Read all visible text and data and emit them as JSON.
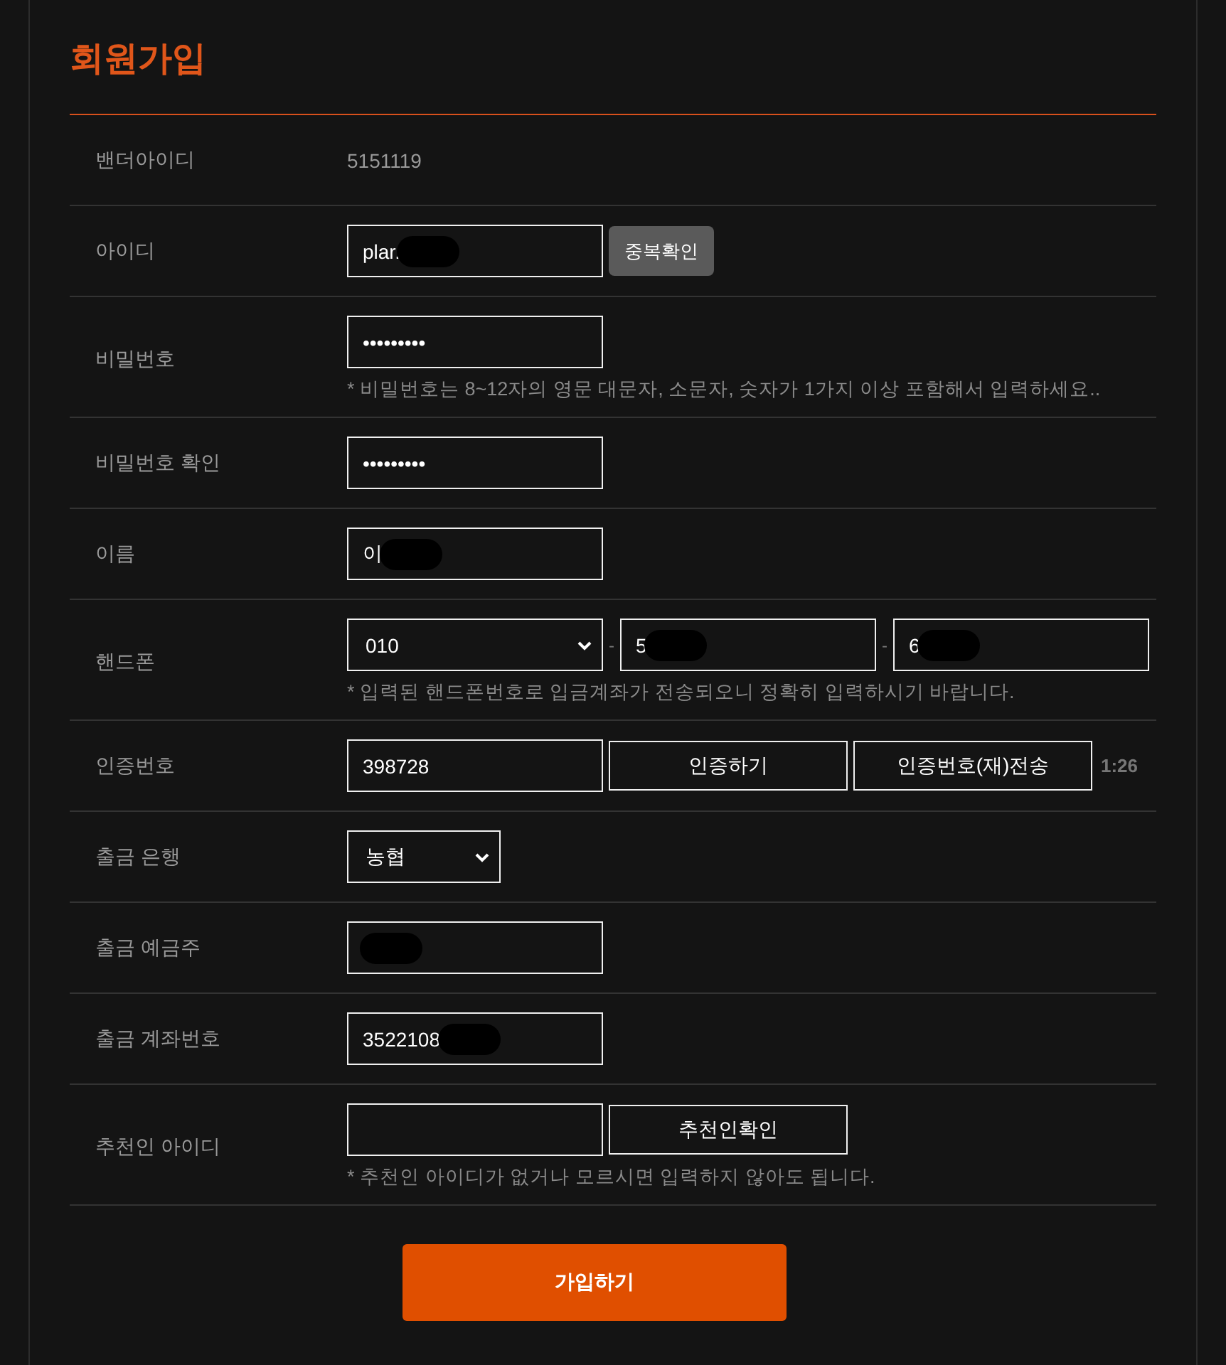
{
  "title": "회원가입",
  "rows": [
    {
      "label": "밴더아이디",
      "controls": [
        {
          "kind": "static",
          "text": "5151119"
        }
      ]
    },
    {
      "label": "아이디",
      "controls": [
        {
          "kind": "input",
          "value": "plar.",
          "redacted": true
        },
        {
          "kind": "gray-button",
          "text": "중복확인"
        }
      ]
    },
    {
      "label": "비밀번호",
      "controls": [
        {
          "kind": "input",
          "value": "•••••••••"
        }
      ],
      "hint": "* 비밀번호는 8~12자의 영문 대문자, 소문자, 숫자가 1가지 이상 포함해서 입력하세요.."
    },
    {
      "label": "비밀번호 확인",
      "controls": [
        {
          "kind": "input",
          "value": "•••••••••"
        }
      ]
    },
    {
      "label": "이름",
      "controls": [
        {
          "kind": "input",
          "value": "이",
          "redacted": true
        }
      ]
    },
    {
      "label": "핸드폰",
      "controls": [
        {
          "kind": "select",
          "value": "010"
        },
        {
          "kind": "separator",
          "text": "-"
        },
        {
          "kind": "input",
          "value": "5",
          "redacted": true
        },
        {
          "kind": "separator",
          "text": "-"
        },
        {
          "kind": "input",
          "value": "6",
          "redacted": true
        }
      ],
      "hint": "* 입력된 핸드폰번호로 입금계좌가 전송되오니 정확히 입력하시기 바랍니다."
    },
    {
      "label": "인증번호",
      "controls": [
        {
          "kind": "input",
          "value": "398728"
        },
        {
          "kind": "button",
          "text": "인증하기"
        },
        {
          "kind": "button",
          "text": "인증번호(재)전송"
        },
        {
          "kind": "timer",
          "text": "1:26"
        }
      ]
    },
    {
      "label": "출금 은행",
      "controls": [
        {
          "kind": "small-select",
          "value": "농협"
        }
      ]
    },
    {
      "label": "출금 예금주",
      "controls": [
        {
          "kind": "input",
          "redacted": true
        }
      ]
    },
    {
      "label": "출금 계좌번호",
      "controls": [
        {
          "kind": "input",
          "value": "3522108",
          "redacted": true
        }
      ]
    },
    {
      "label": "추천인 아이디",
      "controls": [
        {
          "kind": "input"
        },
        {
          "kind": "button",
          "text": "추천인확인"
        }
      ],
      "hint": "* 추천인 아이디가 없거나 모르시면 입력하지 않아도 됩니다."
    }
  ],
  "submit": "가입하기"
}
